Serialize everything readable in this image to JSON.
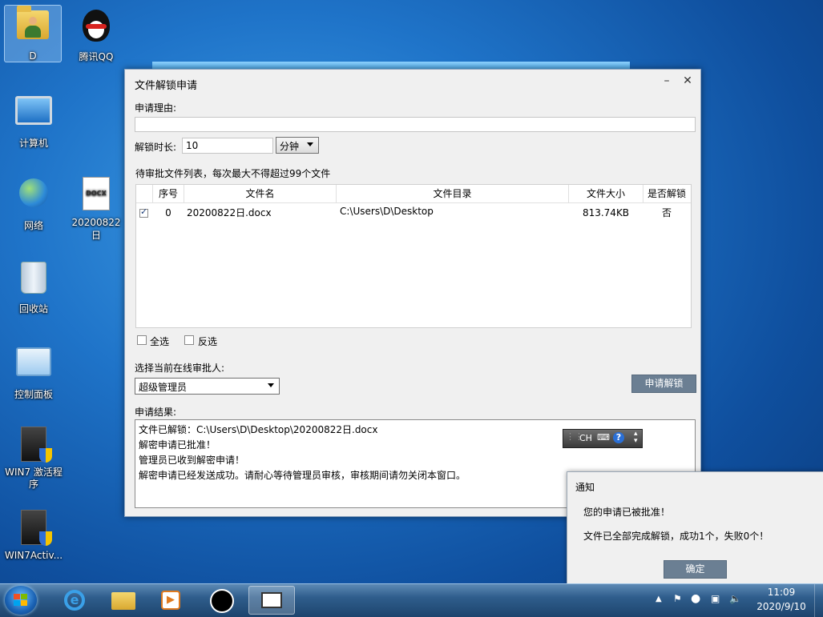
{
  "desktop": {
    "icons": [
      {
        "label": "D"
      },
      {
        "label": "腾讯QQ"
      },
      {
        "label": "计算机"
      },
      {
        "label": "网络"
      },
      {
        "label": "20200822日"
      },
      {
        "label": "回收站"
      },
      {
        "label": "控制面板"
      },
      {
        "label": "WIN7 激活程序"
      },
      {
        "label": "WIN7Activ..."
      }
    ]
  },
  "dialog": {
    "title": "文件解锁申请",
    "reason_label": "申请理由:",
    "reason_value": "",
    "duration_label": "解锁时长:",
    "duration_value": "10",
    "duration_unit": "分钟",
    "list_label": "待审批文件列表，每次最大不得超过99个文件",
    "columns": [
      "序号",
      "文件名",
      "文件目录",
      "文件大小",
      "是否解锁"
    ],
    "rows": [
      {
        "checked": true,
        "index": "0",
        "name": "20200822日.docx",
        "dir": "C:\\Users\\D\\Desktop",
        "size": "813.74KB",
        "unlocked": "否"
      }
    ],
    "select_all": "全选",
    "invert_select": "反选",
    "approver_label": "选择当前在线审批人:",
    "approver_value": "超级管理员",
    "apply_button": "申请解锁",
    "result_label": "申请结果:",
    "result_lines": [
      "文件已解锁：C:\\Users\\D\\Desktop\\20200822日.docx",
      "解密申请已批准！",
      "管理员已收到解密申请！",
      "解密申请已经发送成功。请耐心等待管理员审核，审核期间请勿关闭本窗口。"
    ]
  },
  "ime": {
    "text": "CH"
  },
  "notification": {
    "title": "通知",
    "line1": "您的申请已被批准！",
    "line2": "文件已全部完成解锁，成功1个，失败0个！",
    "ok_button": "确定"
  },
  "taskbar": {
    "time": "11:09",
    "date": "2020/9/10"
  }
}
